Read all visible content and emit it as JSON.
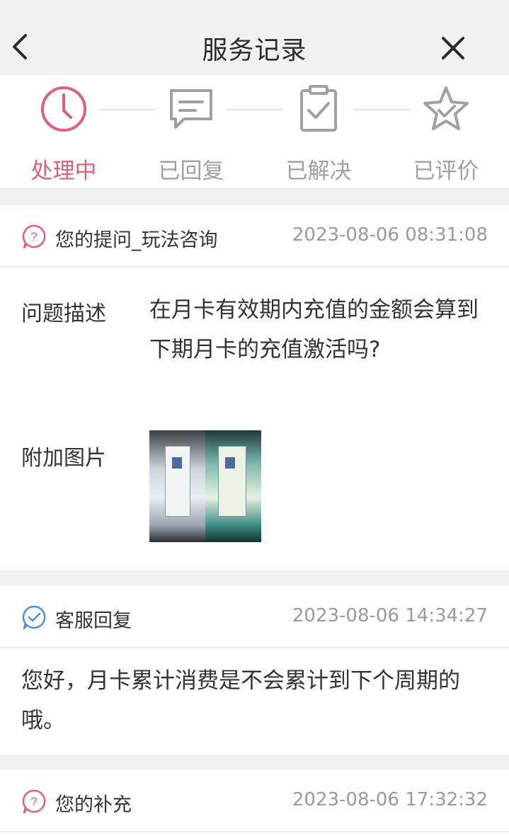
{
  "header": {
    "title": "服务记录"
  },
  "steps": [
    {
      "label": "处理中",
      "icon": "clock-icon",
      "active": true
    },
    {
      "label": "已回复",
      "icon": "chat-bubble-icon",
      "active": false
    },
    {
      "label": "已解决",
      "icon": "clipboard-check-icon",
      "active": false
    },
    {
      "label": "已评价",
      "icon": "star-check-icon",
      "active": false
    }
  ],
  "question": {
    "title": "您的提问_玩法咨询",
    "time": "2023-08-06 08:31:08",
    "desc_label": "问题描述",
    "desc_text": "在月卡有效期内充值的金额会算到下期月卡的充值激活吗?",
    "attach_label": "附加图片"
  },
  "reply": {
    "title": "客服回复",
    "time": "2023-08-06 14:34:27",
    "text": "您好，月卡累计消费是不会累计到下个周期的哦。"
  },
  "supplement": {
    "title": "您的补充",
    "time": "2023-08-06 17:32:32"
  },
  "colors": {
    "accent": "#e0607a",
    "inactive": "#a0a0a0",
    "reply_icon": "#4a90d9"
  }
}
